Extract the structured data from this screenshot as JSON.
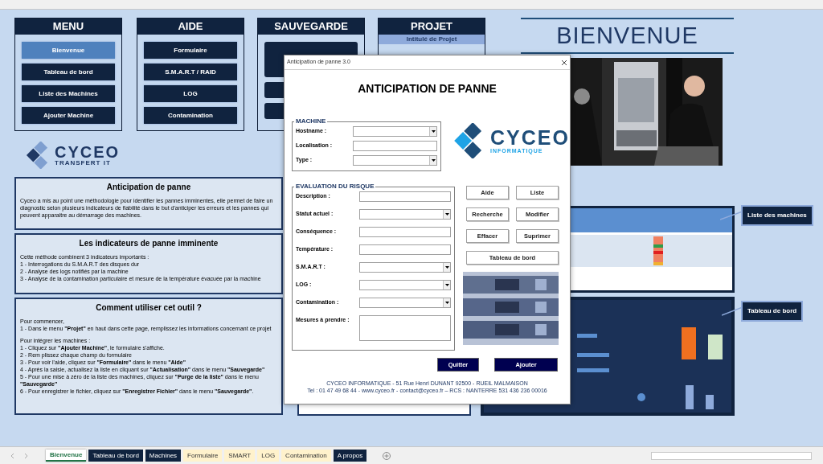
{
  "menus": [
    {
      "title": "MENU",
      "buttons": [
        {
          "label": "Bienvenue",
          "selected": true
        },
        {
          "label": "Tableau de bord",
          "selected": false
        },
        {
          "label": "Liste des Machines",
          "selected": false
        },
        {
          "label": "Ajouter Machine",
          "selected": false
        }
      ]
    },
    {
      "title": "AIDE",
      "buttons": [
        {
          "label": "Formulaire",
          "selected": false
        },
        {
          "label": "S.M.A.R.T / RAID",
          "selected": false
        },
        {
          "label": "LOG",
          "selected": false
        },
        {
          "label": "Contamination",
          "selected": false
        }
      ]
    },
    {
      "title": "SAUVEGARDE",
      "buttons": [
        {
          "kind": "large"
        },
        {
          "kind": "small"
        },
        {
          "kind": "small"
        }
      ]
    },
    {
      "title": "PROJET",
      "subtitle": "Intitulé de Projet"
    }
  ],
  "logo": {
    "name": "CYCEO",
    "tagline": "TRANSFERT IT"
  },
  "panels": [
    {
      "title": "Anticipation de panne",
      "sections": [
        [
          "Cyceo a mis au point une méthodologie pour identifier les pannes imminentes, elle permet de faire un diagnostic selon plusieurs indicateurs de fiabilité dans le but d'anticiper les erreurs et les pannes qui peuvent apparaitre au démarrage des machines."
        ]
      ]
    },
    {
      "title": "Les indicateurs de panne imminente",
      "sections": [
        [
          "Cette méthode combinent 3 indicateurs importants :",
          "1 - Interrogations du S.M.A.R.T des disques dur",
          "2 - Analyse des logs notifiés par la machine",
          "3 - Analyse de la contamination particulaire et mesure de la température évacuée par la machine"
        ]
      ]
    },
    {
      "title": "Comment utiliser cet outil ?",
      "sections": [
        [
          "Pour commencer,",
          "1 - Dans le menu **\"Projet\"** en haut dans cette page, remplissez les informations concernant ce projet"
        ],
        [
          "Pour intégrer les machines :",
          "1 - Cliquez sur **\"Ajouter Machine\"**, le formulaire s'affiche.",
          "2 - Rem plissez chaque champ du formulaire",
          "3 - Pour voir l'aide, cliquez sur **\"Formulaire\"** dans le menu **\"Aide\"**",
          "4 - Après la saisie, actualisez la liste en cliquant sur **\"Actualisation\"** dans le menu **\"Sauvegarde\"**",
          "5 - Pour une mise à zéro de la liste des machines, cliquez sur **\"Purge de la liste\"** dans le menu **\"Sauvegarde\"**",
          "6 - Pour enregistrer le fichier, cliquez sur **\"Enregistrer Fichier\"** dans le menu **\"Sauvegarde\"**."
        ]
      ]
    }
  ],
  "welcome": {
    "title": "BIENVENUE"
  },
  "callouts": [
    "Liste des machines",
    "Tableau de bord"
  ],
  "dialog": {
    "title": "Anticipation de panne 3.0",
    "heading": "ANTICIPATION DE PANNE",
    "machine": {
      "legend": "MACHINE",
      "fields": [
        {
          "label": "Hostname :",
          "kind": "combo"
        },
        {
          "label": "Localisation :",
          "kind": "text"
        },
        {
          "label": "Type :",
          "kind": "combo"
        }
      ]
    },
    "risk": {
      "legend": "EVALUATION DU RISQUE",
      "fields": [
        {
          "label": "Description :",
          "kind": "text"
        },
        {
          "label": "Statut actuel :",
          "kind": "combo"
        },
        {
          "label": "Conséquence :",
          "kind": "text"
        },
        {
          "label": "Température :",
          "kind": "text"
        },
        {
          "label": "S.M.A.R.T :",
          "kind": "combo"
        },
        {
          "label": "LOG :",
          "kind": "combo"
        },
        {
          "label": "Contamination :",
          "kind": "combo"
        },
        {
          "label": "Mesures à prendre :",
          "kind": "area"
        }
      ]
    },
    "logo": {
      "name": "CYCEO",
      "tagline": "INFORMATIQUE"
    },
    "actions": [
      "Aide",
      "Liste",
      "Recherche",
      "Modifier",
      "Effacer",
      "Suprimer"
    ],
    "wide_action": "Tableau de bord",
    "footer_buttons": [
      "Quitter",
      "Ajouter"
    ],
    "footer": [
      "CYCEO INFORMATIQUE -  51 Rue Henri DUNANT 92500 - RUEIL MALMAISON",
      "Tel : 01 47 49 68 44 - www.cyceo.fr - contact@cyceo.fr – RCS : NANTERRE 531 436 236 00016"
    ]
  },
  "sheet_tabs": [
    {
      "label": "Bienvenue",
      "selected": true,
      "color": "#ffffff"
    },
    {
      "label": "Tableau de bord",
      "selected": false,
      "color": "#10233f"
    },
    {
      "label": "Machines",
      "selected": false,
      "color": "#10233f"
    },
    {
      "label": "Formulaire",
      "selected": false,
      "color": "#fff2cc"
    },
    {
      "label": "SMART",
      "selected": false,
      "color": "#fff2cc"
    },
    {
      "label": "LOG",
      "selected": false,
      "color": "#fff2cc"
    },
    {
      "label": "Contamination",
      "selected": false,
      "color": "#fff2cc"
    },
    {
      "label": "A propos",
      "selected": false,
      "color": "#10233f"
    }
  ]
}
